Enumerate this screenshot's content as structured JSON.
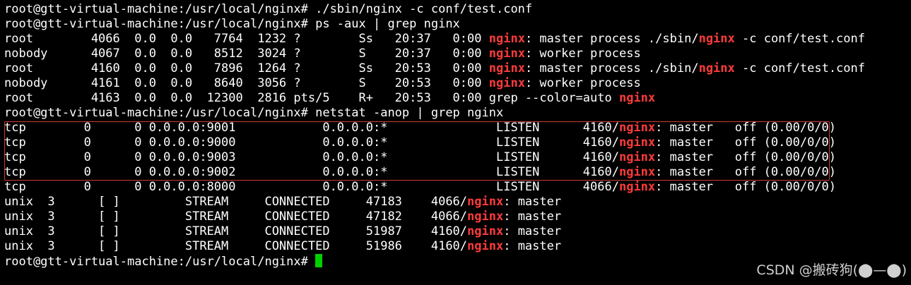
{
  "terminal": {
    "highlight_word": "nginx",
    "lines": [
      "root@gtt-virtual-machine:/usr/local/nginx# ./sbin/nginx -c conf/test.conf",
      "root@gtt-virtual-machine:/usr/local/nginx# ps -aux | grep nginx",
      "root        4066  0.0  0.0   7764  1232 ?        Ss   20:37   0:00 nginx: master process ./sbin/nginx -c conf/test.conf",
      "nobody      4067  0.0  0.0   8512  3024 ?        S    20:37   0:00 nginx: worker process",
      "root        4160  0.0  0.0   7896  1264 ?        Ss   20:53   0:00 nginx: master process ./sbin/nginx -c conf/test.conf",
      "nobody      4161  0.0  0.0   8640  3056 ?        S    20:53   0:00 nginx: worker process",
      "root        4163  0.0  0.0  12300  2816 pts/5    R+   20:53   0:00 grep --color=auto nginx",
      "root@gtt-virtual-machine:/usr/local/nginx# netstat -anop | grep nginx",
      "tcp        0      0 0.0.0.0:9001            0.0.0.0:*               LISTEN      4160/nginx: master   off (0.00/0/0)",
      "tcp        0      0 0.0.0.0:9000            0.0.0.0:*               LISTEN      4160/nginx: master   off (0.00/0/0)",
      "tcp        0      0 0.0.0.0:9003            0.0.0.0:*               LISTEN      4160/nginx: master   off (0.00/0/0)",
      "tcp        0      0 0.0.0.0:9002            0.0.0.0:*               LISTEN      4160/nginx: master   off (0.00/0/0)",
      "tcp        0      0 0.0.0.0:8000            0.0.0.0:*               LISTEN      4066/nginx: master   off (0.00/0/0)",
      "unix  3      [ ]         STREAM     CONNECTED     47183    4066/nginx: master",
      "unix  3      [ ]         STREAM     CONNECTED     47182    4066/nginx: master",
      "unix  3      [ ]         STREAM     CONNECTED     51987    4160/nginx: master",
      "unix  3      [ ]         STREAM     CONNECTED     51986    4160/nginx: master",
      "root@gtt-virtual-machine:/usr/local/nginx# "
    ]
  },
  "highlight_color": "#ff3b3b",
  "cursor_color": "#00d000",
  "box_color": "#d33a32",
  "watermark": "CSDN @搬砖狗(⬤—⬤)"
}
